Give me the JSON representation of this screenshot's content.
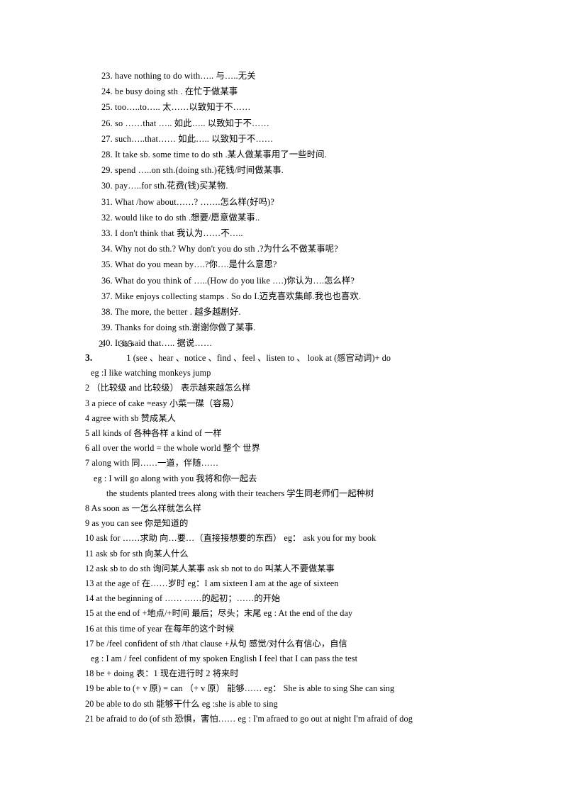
{
  "document": {
    "type": "study-notes",
    "language": "mixed-english-chinese",
    "page_background": "#ffffff",
    "text_color": "#000000"
  },
  "top_section": {
    "lines": [
      "23. have nothing to do with….. 与…..无关",
      "24. be busy doing sth . 在忙于做某事",
      "25. too…..to….. 太……以致知于不……",
      "26. so ……that ….. 如此….. 以致知于不……",
      "27. such…..that…… 如此….. 以致知于不……",
      "28. It take sb. some time to do sth .某人做某事用了一些时间.",
      "29. spend …..on sth.(doing sth.)花钱/时间做某事.",
      "30. pay…..for sth.花费(钱)买某物.",
      "31. What /how about……? …….怎么样(好吗)?",
      "32. would like to do sth .想要/愿意做某事..",
      "33. I don't think that 我认为……不…..",
      "34. Why not do sth.? Why don't you do sth .?为什么不做某事呢?",
      "35. What do you mean by….?你….是什么意思?",
      "36. What do you think of …..(How do you like ….)你认为….怎么样?",
      "37. Mike enjoys collecting stamps . So do I.迈克喜欢集邮.我也也喜欢.",
      "38. The more, the better . 越多越剧好.",
      "39. Thanks for doing sth.谢谢你做了某事.",
      "40. It is said that….. 据说……"
    ]
  },
  "mid_line": {
    "number": "2.",
    "value": "315"
  },
  "bottom_section": {
    "heading_number": "3.",
    "lines": [
      {
        "indent": "heading3",
        "number": "3.",
        "text": "1 (see 、hear 、notice 、find 、feel 、listen to 、 look  at (感官动词)+  do"
      },
      {
        "indent": "indent3",
        "text": "eg :I  like   watching  monkeys  jump"
      },
      {
        "indent": "none",
        "text": "2 （比较级 and 比较级） 表示越来越怎么样"
      },
      {
        "indent": "none",
        "text": "3 a piece of cake =easy  小菜一碟（容易）"
      },
      {
        "indent": "none",
        "text": "4 agree with sb  赞成某人"
      },
      {
        "indent": "none",
        "text": "5 all kinds of  各种各样   a kind of   一样"
      },
      {
        "indent": "none",
        "text": "6 all over the world = the whole world   整个 世界"
      },
      {
        "indent": "none",
        "text": "7 along with  同……一道，伴随……"
      },
      {
        "indent": "indent1",
        "text": "eg : I will go along with you  我将和你一起去"
      },
      {
        "indent": "indent2",
        "text": "the students planted trees along with their teachers  学生同老师们一起种树"
      },
      {
        "indent": "none",
        "text": "8 As soon as  一怎么样就怎么样"
      },
      {
        "indent": "none",
        "text": "9 as you can see  你是知道的"
      },
      {
        "indent": "none",
        "text": "10 ask for ……求助  向…要…（直接接想要的东西） eg： ask you for my book"
      },
      {
        "indent": "none",
        "text": "11 ask sb for sth  向某人什么"
      },
      {
        "indent": "none",
        "text": "12 ask sb to do sth  询问某人某事     ask sb not to do  叫某人不要做某事"
      },
      {
        "indent": "none",
        "text": "13 at the age of  在……岁时    eg：I am sixteen    I am at the age of sixteen"
      },
      {
        "indent": "none",
        "text": "14 at the beginning of ……   ……的起初；……的开始"
      },
      {
        "indent": "none",
        "text": "15 at the end of +地点/+时间  最后；尽头；末尾   eg : At the end of the day"
      },
      {
        "indent": "none",
        "text": "16 at this time of year  在每年的这个时候"
      },
      {
        "indent": "none",
        "text": "17 be /feel confident of sth /that clause +从句  感觉/对什么有信心，自信"
      },
      {
        "indent": "indent3",
        "text": "eg : I am / feel confident of my spoken English  I feel that I can pass the test"
      },
      {
        "indent": "none",
        "text": "18 be + doing  表：1 现在进行时 2 将来时"
      },
      {
        "indent": "none",
        "text": "19 be able to (+ v 原) = can （+ v 原）  能够……   eg： She is able to sing     She can sing"
      },
      {
        "indent": "none",
        "text": "20 be able to do sth  能够干什么   eg :she is able to sing"
      },
      {
        "indent": "none",
        "text": "21 be afraid to do (of sth  恐惧，害怕……  eg : I'm afraed to go out at night   I'm afraid of dog"
      }
    ]
  }
}
